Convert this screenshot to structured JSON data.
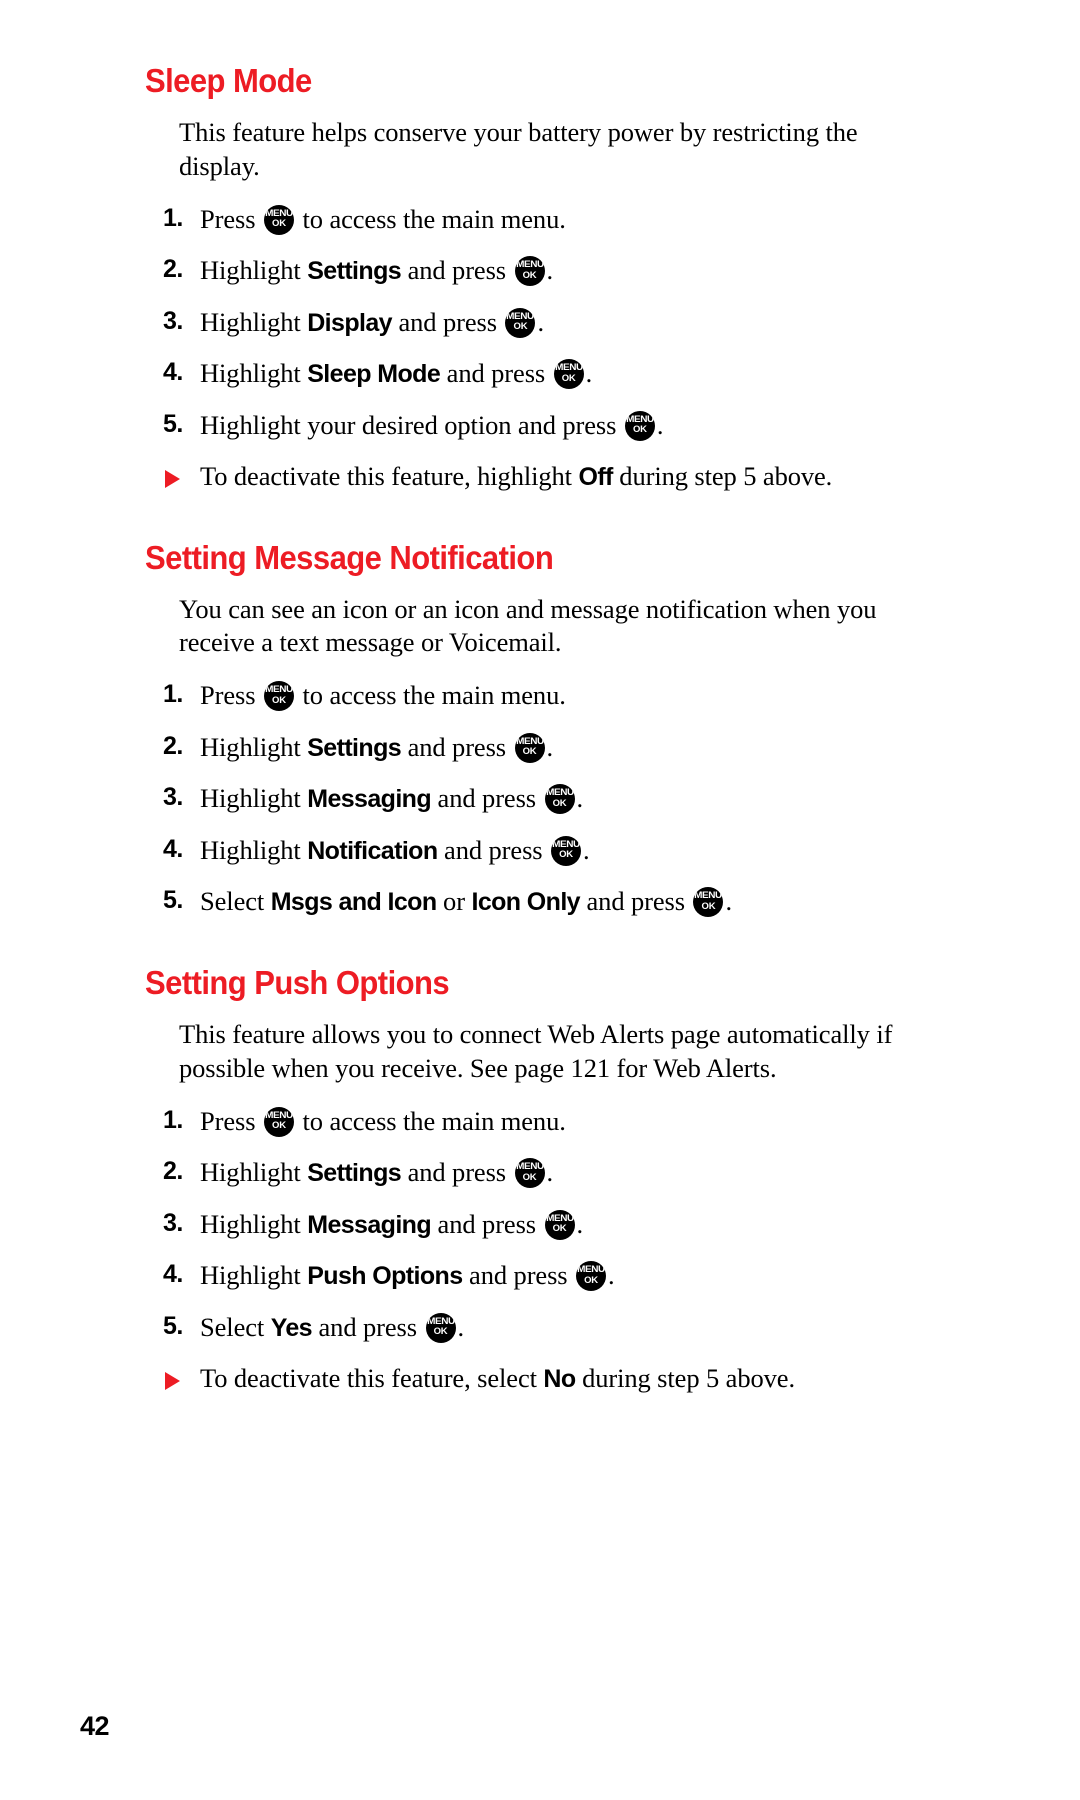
{
  "document": {
    "page_number": "42",
    "accent_color": "#ED1C24",
    "text_color": "#000000",
    "background_color": "#FFFFFF"
  },
  "key_icon": {
    "name": "menu-ok-key-icon",
    "top_label": "MENU",
    "bottom_label": "OK"
  },
  "sections": [
    {
      "id": "sleep-mode",
      "heading": "Sleep Mode",
      "intro": "This feature helps conserve your battery power by restricting the display.",
      "steps": [
        {
          "num": "1.",
          "pre": "Press ",
          "term": "",
          "mid": "",
          "has_key": true,
          "post": " to access the main menu."
        },
        {
          "num": "2.",
          "pre": "Highlight ",
          "term": "Settings",
          "mid": " and press ",
          "has_key": true,
          "post": "."
        },
        {
          "num": "3.",
          "pre": "Highlight ",
          "term": "Display",
          "mid": " and press ",
          "has_key": true,
          "post": "."
        },
        {
          "num": "4.",
          "pre": "Highlight ",
          "term": "Sleep Mode",
          "mid": " and press ",
          "has_key": true,
          "post": "."
        },
        {
          "num": "5.",
          "pre": "Highlight your desired option and press ",
          "term": "",
          "mid": "",
          "has_key": true,
          "post": "."
        }
      ],
      "note": {
        "pre": "To deactivate this feature, highlight ",
        "term": "Off",
        "post": " during step 5 above."
      }
    },
    {
      "id": "setting-message-notification",
      "heading": "Setting Message Notification",
      "intro": "You can see an icon or an icon and message notification when you receive a text message or Voicemail.",
      "steps": [
        {
          "num": "1.",
          "pre": "Press ",
          "term": "",
          "mid": "",
          "has_key": true,
          "post": " to access the main menu."
        },
        {
          "num": "2.",
          "pre": "Highlight ",
          "term": "Settings",
          "mid": " and press ",
          "has_key": true,
          "post": "."
        },
        {
          "num": "3.",
          "pre": "Highlight ",
          "term": "Messaging",
          "mid": " and press ",
          "has_key": true,
          "post": "."
        },
        {
          "num": "4.",
          "pre": "Highlight ",
          "term": "Notification",
          "mid": " and press ",
          "has_key": true,
          "post": "."
        },
        {
          "num": "5.",
          "pre": "Select ",
          "term": "Msgs and Icon",
          "mid2": " or ",
          "term2": "Icon Only",
          "mid": " and press ",
          "has_key": true,
          "post": "."
        }
      ],
      "note": null
    },
    {
      "id": "setting-push-options",
      "heading": "Setting Push Options",
      "intro": "This feature allows you to connect Web Alerts page automatically if possible when you receive. See page 121 for Web Alerts.",
      "steps": [
        {
          "num": "1.",
          "pre": "Press ",
          "term": "",
          "mid": "",
          "has_key": true,
          "post": " to access the main menu."
        },
        {
          "num": "2.",
          "pre": "Highlight ",
          "term": "Settings",
          "mid": " and press ",
          "has_key": true,
          "post": "."
        },
        {
          "num": "3.",
          "pre": "Highlight ",
          "term": "Messaging",
          "mid": " and press ",
          "has_key": true,
          "post": "."
        },
        {
          "num": "4.",
          "pre": "Highlight ",
          "term": "Push Options",
          "mid": " and press ",
          "has_key": true,
          "post": "."
        },
        {
          "num": "5.",
          "pre": "Select ",
          "term": "Yes",
          "mid": " and press ",
          "has_key": true,
          "post": "."
        }
      ],
      "note": {
        "pre": "To deactivate this feature, select ",
        "term": "No",
        "post": " during step 5 above."
      }
    }
  ]
}
